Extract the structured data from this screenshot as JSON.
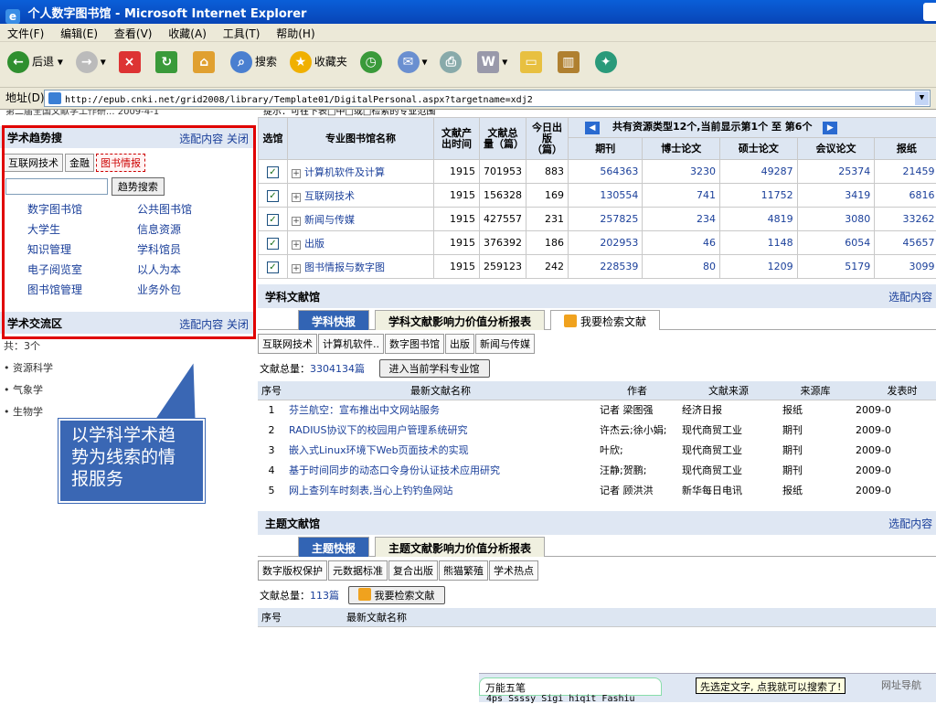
{
  "window": {
    "title": "个人数字图书馆 - Microsoft Internet Explorer"
  },
  "menu": [
    "文件(F)",
    "编辑(E)",
    "查看(V)",
    "收藏(A)",
    "工具(T)",
    "帮助(H)"
  ],
  "toolbar": {
    "back": "后退",
    "search": "搜索",
    "favorites": "收藏夹"
  },
  "address": {
    "label": "地址(D)",
    "url": "http://epub.cnki.net/grid2008/library/Template01/DigitalPersonal.aspx?targetname=xdj2"
  },
  "left": {
    "top_clip": "第二届全国文献学工作研...        2009-4-1",
    "trend": {
      "title": "学术趋势搜",
      "actions": "选配内容 关闭",
      "keywords": [
        "互联网技术",
        "金融",
        "图书情报"
      ],
      "search_btn": "趋势搜索",
      "links": [
        "数字图书馆",
        "公共图书馆",
        "大学生",
        "信息资源",
        "知识管理",
        "学科馆员",
        "电子阅览室",
        "以人为本",
        "图书馆管理",
        "业务外包"
      ]
    },
    "exchange": {
      "title": "学术交流区",
      "actions": "选配内容 关闭",
      "count": "共：3个",
      "items": [
        "• 资源科学",
        "• 气象学",
        "• 生物学"
      ]
    },
    "callout": "以学科学术趋势为线索的情报服务"
  },
  "libtable": {
    "top_clip": "提示：可在下表□中□或□检索的专业范围",
    "headers": [
      "选馆",
      "专业图书馆名称",
      "文献产出时间",
      "文献总量（篇）",
      "今日出版（篇）",
      "期刊",
      "博士论文",
      "硕士论文",
      "会议论文",
      "报纸"
    ],
    "pager": "共有资源类型12个,当前显示第1个 至 第6个",
    "rows": [
      {
        "name": "计算机软件及计算",
        "year": "1915",
        "total": "701953",
        "today": "883",
        "qk": "564363",
        "bs": "3230",
        "ss": "49287",
        "hy": "25374",
        "bz": "21459"
      },
      {
        "name": "互联网技术",
        "year": "1915",
        "total": "156328",
        "today": "169",
        "qk": "130554",
        "bs": "741",
        "ss": "11752",
        "hy": "3419",
        "bz": "6816"
      },
      {
        "name": "新闻与传媒",
        "year": "1915",
        "total": "427557",
        "today": "231",
        "qk": "257825",
        "bs": "234",
        "ss": "4819",
        "hy": "3080",
        "bz": "33262"
      },
      {
        "name": "出版",
        "year": "1915",
        "total": "376392",
        "today": "186",
        "qk": "202953",
        "bs": "46",
        "ss": "1148",
        "hy": "6054",
        "bz": "45657"
      },
      {
        "name": "图书情报与数字图",
        "year": "1915",
        "total": "259123",
        "today": "242",
        "qk": "228539",
        "bs": "80",
        "ss": "1209",
        "hy": "5179",
        "bz": "3099"
      }
    ]
  },
  "subject": {
    "title": "学科文献馆",
    "actions": "选配内容 关",
    "tabs": [
      "学科快报",
      "学科文献影响力价值分析报表",
      "我要检索文献"
    ],
    "cats": [
      "互联网技术",
      "计算机软件..",
      "数字图书馆",
      "出版",
      "新闻与传媒"
    ],
    "total_label": "文献总量：",
    "total_val": "3304134篇",
    "enter_btn": "进入当前学科专业馆",
    "headers": [
      "序号",
      "最新文献名称",
      "作者",
      "文献来源",
      "来源库",
      "发表时"
    ],
    "rows": [
      {
        "no": "1",
        "title": "芬兰航空：宣布推出中文网站服务",
        "author": "记者 梁图强",
        "src": "经济日报",
        "db": "报纸",
        "date": "2009-0"
      },
      {
        "no": "2",
        "title": "RADIUS协议下的校园用户管理系统研究",
        "author": "许杰云;徐小娟;",
        "src": "现代商贸工业",
        "db": "期刊",
        "date": "2009-0"
      },
      {
        "no": "3",
        "title": "嵌入式Linux环境下Web页面技术的实现",
        "author": "叶欣;",
        "src": "现代商贸工业",
        "db": "期刊",
        "date": "2009-0"
      },
      {
        "no": "4",
        "title": "基于时间同步的动态口令身份认证技术应用研究",
        "author": "汪静;贺鹏;",
        "src": "现代商贸工业",
        "db": "期刊",
        "date": "2009-0"
      },
      {
        "no": "5",
        "title": "网上查列车时刻表,当心上钓钓鱼网站",
        "author": "记者 顾洪洪",
        "src": "新华每日电讯",
        "db": "报纸",
        "date": "2009-0"
      }
    ]
  },
  "theme": {
    "title": "主题文献馆",
    "actions": "选配内容 关",
    "tabs": [
      "主题快报",
      "主题文献影响力价值分析报表"
    ],
    "cats": [
      "数字版权保护",
      "元数据标准",
      "复合出版",
      "熊猫繁殖",
      "学术热点"
    ],
    "total_label": "文献总量：",
    "total_val": "113篇",
    "search": "我要检索文献",
    "headers": [
      "序号",
      "最新文献名称"
    ]
  },
  "status": {
    "ime": "万能五笔",
    "tip": "先选定文字, 点我就可以搜索了!",
    "nav": "网址导航",
    "bottom": "4ps Ssssy Sigi hiqit Fashiu"
  }
}
